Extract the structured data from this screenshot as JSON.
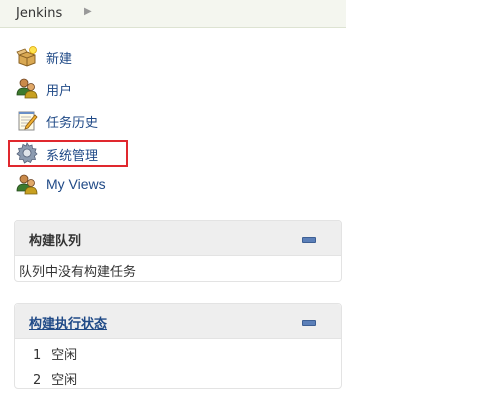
{
  "breadcrumb": {
    "root": "Jenkins"
  },
  "tasks": [
    {
      "label": "新建",
      "icon": "new-item-icon"
    },
    {
      "label": "用户",
      "icon": "users-icon"
    },
    {
      "label": "任务历史",
      "icon": "build-history-icon"
    },
    {
      "label": "系统管理",
      "icon": "gear-icon"
    },
    {
      "label": "My Views",
      "icon": "users-icon"
    }
  ],
  "build_queue": {
    "title": "构建队列",
    "empty_text": "队列中没有构建任务"
  },
  "executors": {
    "title": "构建执行状态",
    "rows": [
      {
        "num": "1",
        "status": "空闲"
      },
      {
        "num": "2",
        "status": "空闲"
      }
    ]
  },
  "colors": {
    "link": "#204a87",
    "highlight": "#e0282e",
    "breadcrumb_bg": "#f4f6ef",
    "pane_header_bg": "#eeeeee"
  }
}
